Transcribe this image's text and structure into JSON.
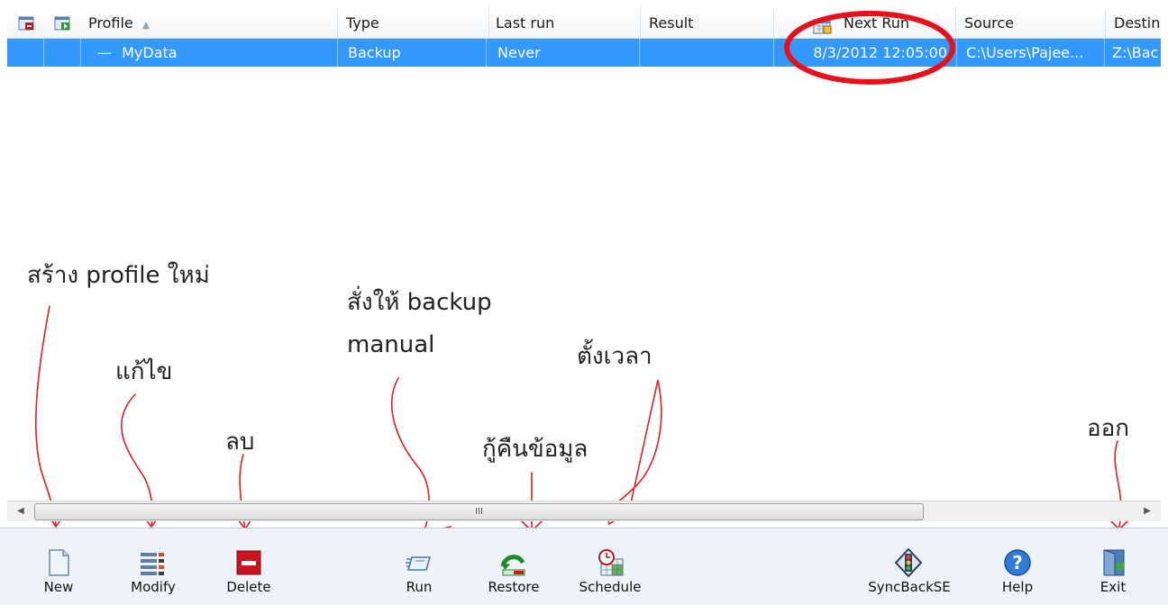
{
  "columns": {
    "profile": "Profile",
    "type": "Type",
    "last_run": "Last run",
    "result": "Result",
    "next_run": "Next Run",
    "source": "Source",
    "destination": "Destin"
  },
  "rows": [
    {
      "profile": "MyData",
      "type": "Backup",
      "last_run": "Never",
      "result": "",
      "next_run": "8/3/2012 12:05:00",
      "source": "C:\\Users\\Pajee...",
      "destination": "Z:\\Bac"
    }
  ],
  "scrollbar": {
    "grip": "III"
  },
  "toolbar": {
    "new": "New",
    "modify": "Modify",
    "delete": "Delete",
    "run": "Run",
    "restore": "Restore",
    "schedule": "Schedule",
    "syncbackse": "SyncBackSE",
    "help": "Help",
    "exit": "Exit"
  },
  "annotations": {
    "new": "สร้าง profile ใหม่",
    "modify": "แก้ไข",
    "delete": "ลบ",
    "run_line1": "สั่งให้ backup",
    "run_line2": "manual",
    "restore": "กู้คืนข้อมูล",
    "schedule": "ตั้งเวลา",
    "exit": "ออก"
  },
  "colors": {
    "selection": "#3399ff",
    "annotation_ink": "#e02020",
    "highlight_circle": "#e8101a"
  },
  "icons": [
    "new-profile-icon",
    "run-profile-icon",
    "new-icon",
    "modify-icon",
    "delete-icon",
    "run-icon",
    "restore-icon",
    "schedule-icon",
    "syncbackse-icon",
    "help-icon",
    "exit-icon"
  ]
}
